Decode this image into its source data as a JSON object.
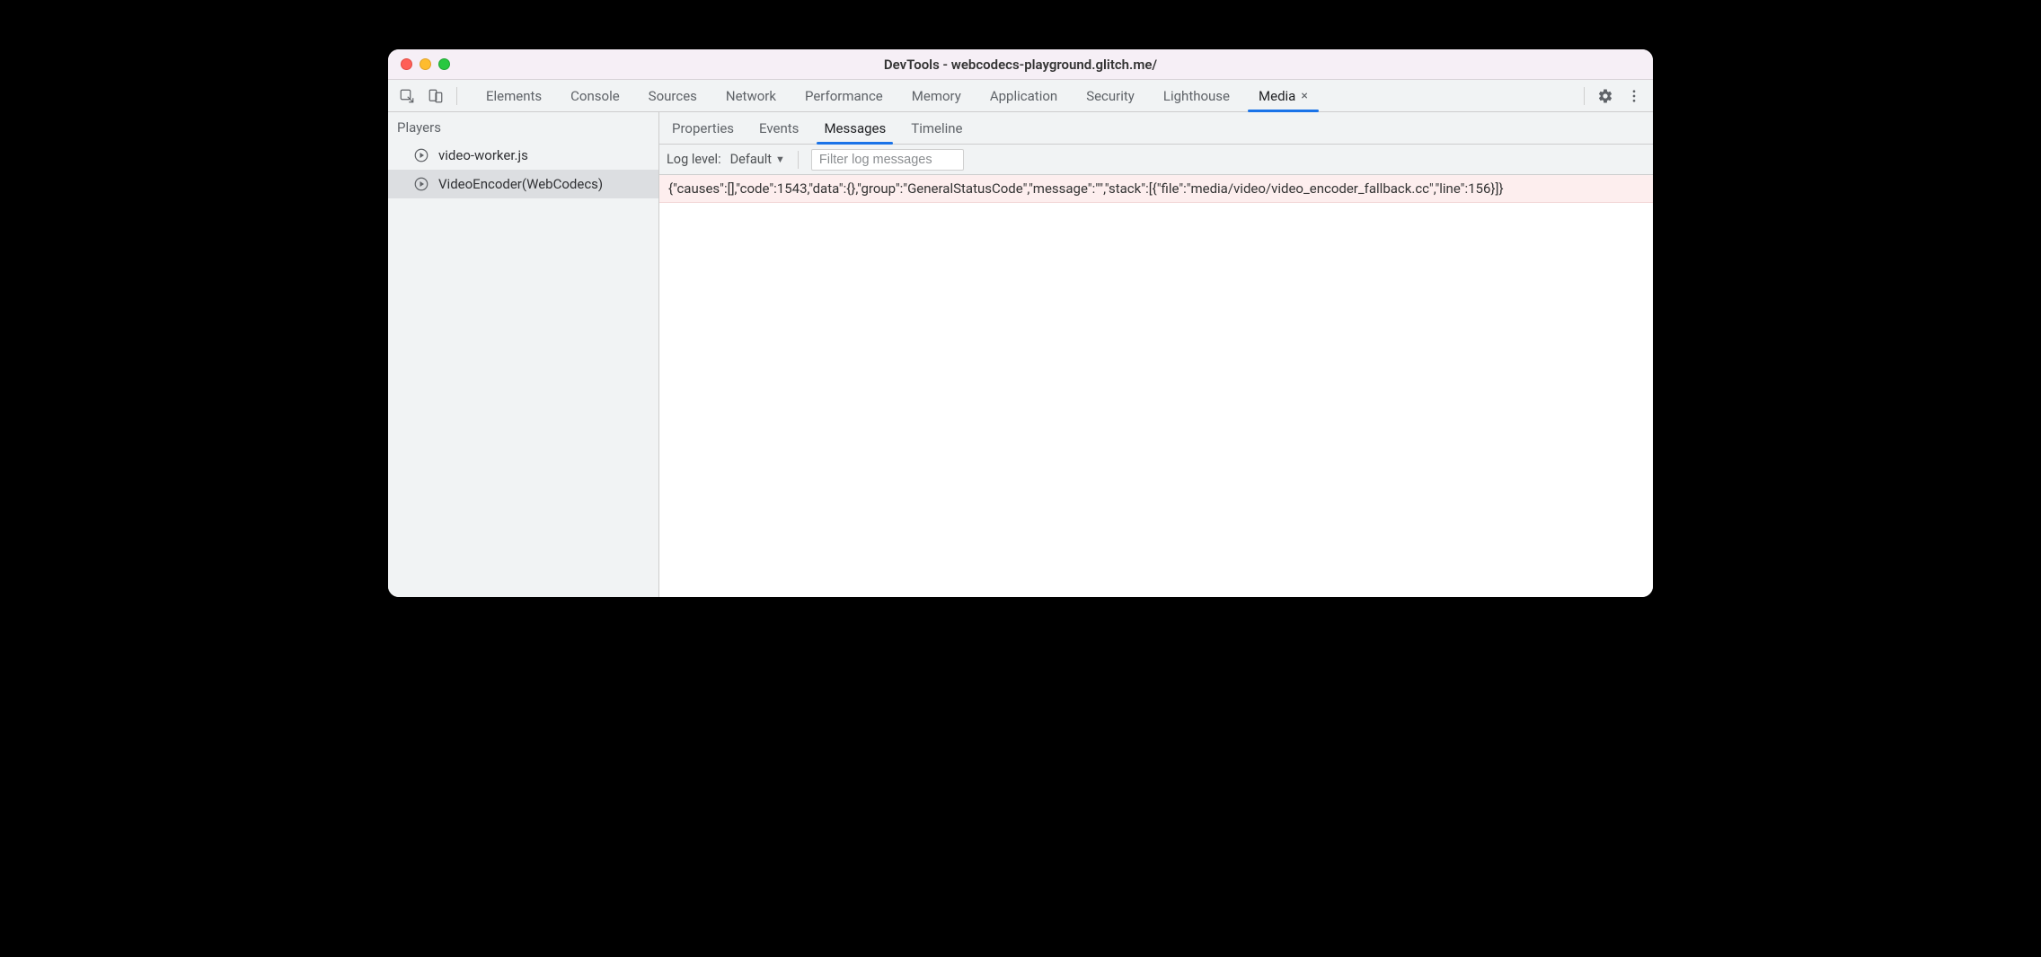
{
  "window": {
    "title": "DevTools - webcodecs-playground.glitch.me/"
  },
  "main_tabs": [
    {
      "label": "Elements",
      "active": false,
      "closable": false
    },
    {
      "label": "Console",
      "active": false,
      "closable": false
    },
    {
      "label": "Sources",
      "active": false,
      "closable": false
    },
    {
      "label": "Network",
      "active": false,
      "closable": false
    },
    {
      "label": "Performance",
      "active": false,
      "closable": false
    },
    {
      "label": "Memory",
      "active": false,
      "closable": false
    },
    {
      "label": "Application",
      "active": false,
      "closable": false
    },
    {
      "label": "Security",
      "active": false,
      "closable": false
    },
    {
      "label": "Lighthouse",
      "active": false,
      "closable": false
    },
    {
      "label": "Media",
      "active": true,
      "closable": true
    }
  ],
  "sidebar": {
    "title": "Players",
    "items": [
      {
        "label": "video-worker.js",
        "selected": false
      },
      {
        "label": "VideoEncoder(WebCodecs)",
        "selected": true
      }
    ]
  },
  "sub_tabs": [
    {
      "label": "Properties",
      "active": false
    },
    {
      "label": "Events",
      "active": false
    },
    {
      "label": "Messages",
      "active": true
    },
    {
      "label": "Timeline",
      "active": false
    }
  ],
  "filter": {
    "label": "Log level:",
    "select_value": "Default",
    "input_placeholder": "Filter log messages"
  },
  "messages": [
    "{\"causes\":[],\"code\":1543,\"data\":{},\"group\":\"GeneralStatusCode\",\"message\":\"\",\"stack\":[{\"file\":\"media/video/video_encoder_fallback.cc\",\"line\":156}]}"
  ]
}
